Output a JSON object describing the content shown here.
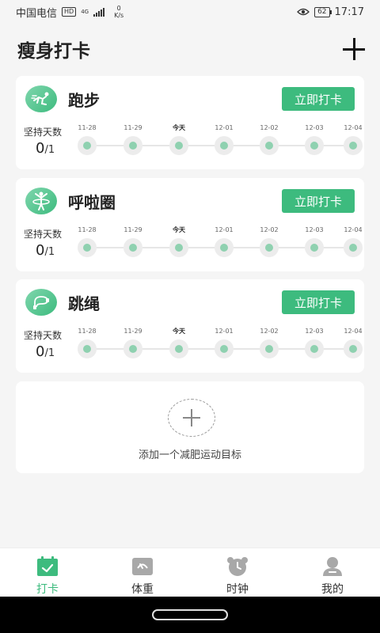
{
  "status_bar": {
    "carrier": "中国电信",
    "hd": "HD",
    "net_type": "4G",
    "speed_value": "0",
    "speed_unit": "K/s",
    "battery": "62",
    "time": "17:17"
  },
  "header": {
    "title": "瘦身打卡"
  },
  "days": [
    {
      "label": "11-28",
      "today": false
    },
    {
      "label": "11-29",
      "today": false
    },
    {
      "label": "今天",
      "today": true
    },
    {
      "label": "12-01",
      "today": false
    },
    {
      "label": "12-02",
      "today": false
    },
    {
      "label": "12-03",
      "today": false
    },
    {
      "label": "12-04",
      "today": false
    }
  ],
  "cards": [
    {
      "name": "跑步",
      "icon": "running-icon",
      "button_label": "立即打卡",
      "streak_label": "坚持天数",
      "streak_value": "0",
      "streak_target": "/1"
    },
    {
      "name": "呼啦圈",
      "icon": "hula-hoop-icon",
      "button_label": "立即打卡",
      "streak_label": "坚持天数",
      "streak_value": "0",
      "streak_target": "/1"
    },
    {
      "name": "跳绳",
      "icon": "jump-rope-icon",
      "button_label": "立即打卡",
      "streak_label": "坚持天数",
      "streak_value": "0",
      "streak_target": "/1"
    }
  ],
  "add_goal": {
    "text": "添加一个减肥运动目标"
  },
  "tabs": [
    {
      "label": "打卡",
      "icon": "calendar-check-icon",
      "active": true
    },
    {
      "label": "体重",
      "icon": "scale-icon",
      "active": false
    },
    {
      "label": "时钟",
      "icon": "alarm-clock-icon",
      "active": false
    },
    {
      "label": "我的",
      "icon": "user-icon",
      "active": false
    }
  ],
  "colors": {
    "accent": "#3dbb7e",
    "dot": "#8fd1b0",
    "background": "#f5f5f5"
  }
}
